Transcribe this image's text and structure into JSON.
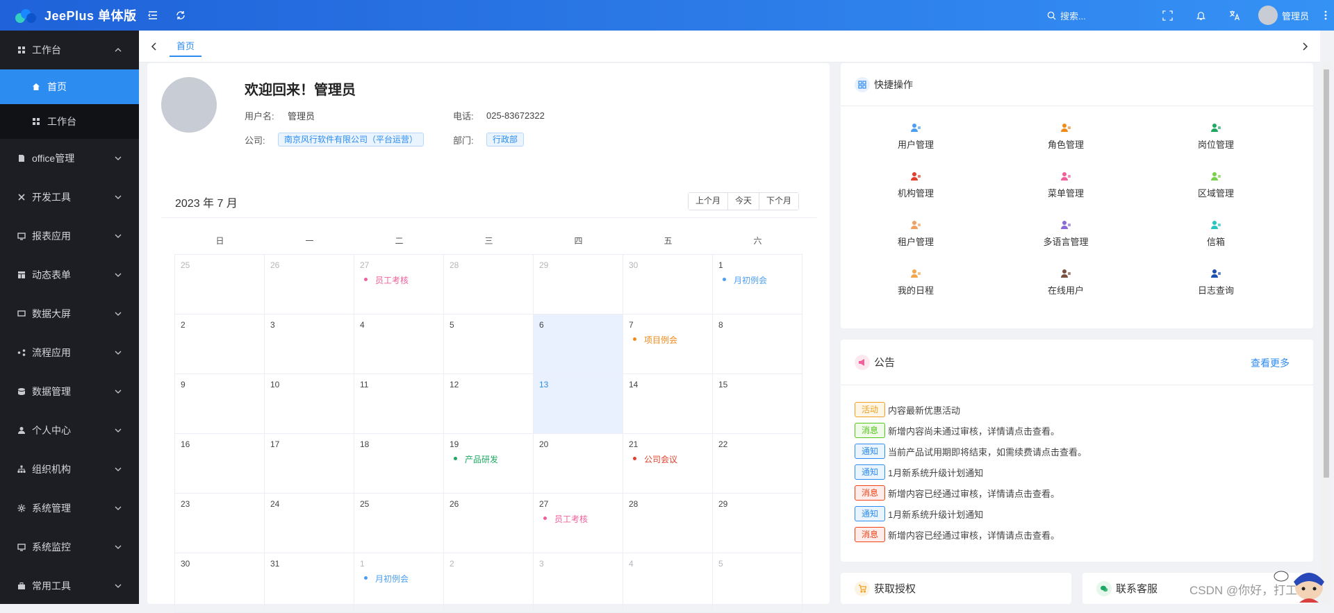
{
  "app": {
    "title": "JeePlus 单体版"
  },
  "topbar": {
    "search_placeholder": "搜索...",
    "user_name": "管理员"
  },
  "sidebar": {
    "items": [
      {
        "label": "工作台",
        "icon": "dashboard-icon",
        "expanded": true
      },
      {
        "label": "office管理",
        "icon": "document-icon"
      },
      {
        "label": "开发工具",
        "icon": "tools-icon"
      },
      {
        "label": "报表应用",
        "icon": "monitor-icon"
      },
      {
        "label": "动态表单",
        "icon": "form-icon"
      },
      {
        "label": "数据大屏",
        "icon": "screen-icon"
      },
      {
        "label": "流程应用",
        "icon": "flow-icon"
      },
      {
        "label": "数据管理",
        "icon": "database-icon"
      },
      {
        "label": "个人中心",
        "icon": "user-icon"
      },
      {
        "label": "组织机构",
        "icon": "org-icon"
      },
      {
        "label": "系统管理",
        "icon": "gear-icon"
      },
      {
        "label": "系统监控",
        "icon": "monitor-icon"
      },
      {
        "label": "常用工具",
        "icon": "toolbox-icon"
      }
    ],
    "sub_items": [
      {
        "label": "首页",
        "icon": "home-icon",
        "active": true
      },
      {
        "label": "工作台",
        "icon": "grid-icon",
        "active": false
      }
    ]
  },
  "tabs": {
    "items": [
      "首页"
    ]
  },
  "welcome": {
    "greeting": "欢迎回来！管理员",
    "username_label": "用户名:",
    "username": "管理员",
    "phone_label": "电话:",
    "phone": "025-83672322",
    "company_label": "公司:",
    "company": "南京风行软件有限公司（平台运营）",
    "dept_label": "部门:",
    "dept": "行政部"
  },
  "calendar": {
    "title": "2023 年 7 月",
    "buttons": [
      "上个月",
      "今天",
      "下个月"
    ],
    "weekdays": [
      "日",
      "一",
      "二",
      "三",
      "四",
      "五",
      "六"
    ],
    "weeks": [
      [
        {
          "n": "25",
          "o": true
        },
        {
          "n": "26",
          "o": true
        },
        {
          "n": "27",
          "o": true,
          "e": "员工考核",
          "c": "#f0609b"
        },
        {
          "n": "28",
          "o": true
        },
        {
          "n": "29",
          "o": true
        },
        {
          "n": "30",
          "o": true
        },
        {
          "n": "1",
          "e": "月初例会",
          "c": "#4c9ff0"
        }
      ],
      [
        {
          "n": "2"
        },
        {
          "n": "3"
        },
        {
          "n": "4"
        },
        {
          "n": "5"
        },
        {
          "n": "6",
          "sel": true
        },
        {
          "n": "7",
          "e": "项目例会",
          "c": "#f08a1a"
        },
        {
          "n": "8"
        }
      ],
      [
        {
          "n": "9"
        },
        {
          "n": "10"
        },
        {
          "n": "11"
        },
        {
          "n": "12"
        },
        {
          "n": "13",
          "sel": true,
          "today": true
        },
        {
          "n": "14"
        },
        {
          "n": "15"
        }
      ],
      [
        {
          "n": "16"
        },
        {
          "n": "17"
        },
        {
          "n": "18"
        },
        {
          "n": "19",
          "e": "产品研发",
          "c": "#1ea862"
        },
        {
          "n": "20"
        },
        {
          "n": "21",
          "e": "公司会议",
          "c": "#e0402c"
        },
        {
          "n": "22"
        }
      ],
      [
        {
          "n": "23"
        },
        {
          "n": "24"
        },
        {
          "n": "25"
        },
        {
          "n": "26"
        },
        {
          "n": "27",
          "e": "员工考核",
          "c": "#f0609b"
        },
        {
          "n": "28"
        },
        {
          "n": "29"
        }
      ],
      [
        {
          "n": "30"
        },
        {
          "n": "31"
        },
        {
          "n": "1",
          "o": true,
          "e": "月初例会",
          "c": "#4c9ff0"
        },
        {
          "n": "2",
          "o": true
        },
        {
          "n": "3",
          "o": true
        },
        {
          "n": "4",
          "o": true
        },
        {
          "n": "5",
          "o": true
        }
      ]
    ]
  },
  "quick": {
    "title": "快捷操作",
    "items": [
      {
        "label": "用户管理",
        "icon": "users-icon",
        "color": "#4c9ff0"
      },
      {
        "label": "角色管理",
        "icon": "role-icon",
        "color": "#f08a1a"
      },
      {
        "label": "岗位管理",
        "icon": "post-icon",
        "color": "#1ea862"
      },
      {
        "label": "机构管理",
        "icon": "org-icon",
        "color": "#e0402c"
      },
      {
        "label": "菜单管理",
        "icon": "menu-icon",
        "color": "#f0609b"
      },
      {
        "label": "区域管理",
        "icon": "region-icon",
        "color": "#7ad04a"
      },
      {
        "label": "租户管理",
        "icon": "tenant-icon",
        "color": "#f0a060"
      },
      {
        "label": "多语言管理",
        "icon": "language-icon",
        "color": "#8a6bd8"
      },
      {
        "label": "信箱",
        "icon": "mailbox-icon",
        "color": "#27c5c0"
      },
      {
        "label": "我的日程",
        "icon": "calendar-icon",
        "color": "#f0a84a"
      },
      {
        "label": "在线用户",
        "icon": "online-user-icon",
        "color": "#7a5040"
      },
      {
        "label": "日志查询",
        "icon": "log-icon",
        "color": "#1f4fb0"
      }
    ]
  },
  "notice": {
    "title": "公告",
    "more": "查看更多",
    "items": [
      {
        "tag": "活动",
        "text": "内容最新优惠活动",
        "color": "#f0a020",
        "bg": "#fdf6e6"
      },
      {
        "tag": "消息",
        "text": "新增内容尚未通过审核，详情请点击查看。",
        "color": "#52c41a",
        "bg": "#f0fae8"
      },
      {
        "tag": "通知",
        "text": "当前产品试用期即将结束，如需续费请点击查看。",
        "color": "#2d8cf0",
        "bg": "#eaf4fe"
      },
      {
        "tag": "通知",
        "text": "1月新系统升级计划通知",
        "color": "#2d8cf0",
        "bg": "#eaf4fe"
      },
      {
        "tag": "消息",
        "text": "新增内容已经通过审核，详情请点击查看。",
        "color": "#ed4014",
        "bg": "#fdecea"
      },
      {
        "tag": "通知",
        "text": "1月新系统升级计划通知",
        "color": "#2d8cf0",
        "bg": "#eaf4fe"
      },
      {
        "tag": "消息",
        "text": "新增内容已经通过审核，详情请点击查看。",
        "color": "#ed4014",
        "bg": "#fdecea"
      }
    ]
  },
  "bottom_cards": [
    {
      "title": "获取授权",
      "icon": "cart-icon"
    },
    {
      "title": "联系客服",
      "icon": "wechat-icon"
    }
  ],
  "watermark": "CSDN @你好，打工人"
}
